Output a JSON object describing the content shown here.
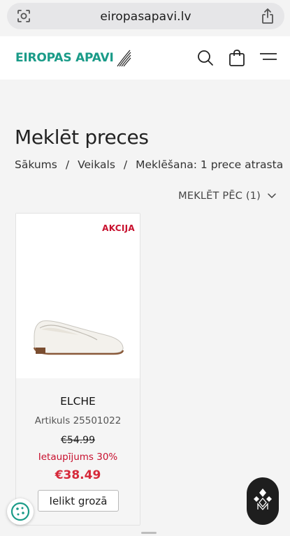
{
  "browser": {
    "url": "eiropasapavi.lv"
  },
  "header": {
    "logo_text": "EIROPAS APAVI",
    "icons": [
      "search-icon",
      "shopping-bag-icon",
      "menu-icon"
    ]
  },
  "page": {
    "title": "Meklēt preces",
    "breadcrumb": [
      "Sākums",
      "Veikals",
      "Meklēšana: 1 prece atrasta"
    ],
    "breadcrumb_separator": "/",
    "filter_label": "MEKLĒT PĒC (1)"
  },
  "products": [
    {
      "badge": "AKCIJA",
      "name": "ELCHE",
      "sku": "Artikuls 25501022",
      "old_price": "€54.99",
      "savings": "Ietaupījums 30%",
      "price": "€38.49",
      "button_label": "Ielikt grozā"
    }
  ],
  "colors": {
    "brand": "#1a9b88",
    "sale": "#c8102e",
    "price": "#d6293a"
  }
}
